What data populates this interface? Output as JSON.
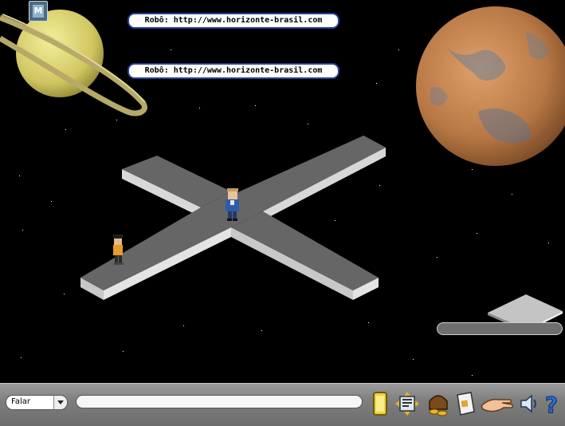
{
  "chat_bubbles": [
    {
      "speaker": "Robô:",
      "message": "http://www.horizonte-brasil.com"
    },
    {
      "speaker": "Robô:",
      "message": "http://www.horizonte-brasil.com"
    }
  ],
  "toolbar": {
    "chat_mode_selected": "Falar",
    "chat_input_value": "",
    "icons": [
      "navigator-icon",
      "catalog-icon",
      "purse-icon",
      "hand-icon",
      "inventory-icon",
      "sound-icon",
      "help-icon"
    ]
  },
  "colors": {
    "bubble_border": "#2a3fa0",
    "floor_top": "#666666",
    "floor_side": "#d4d4d4",
    "toolbar": "#8a8a8a"
  }
}
